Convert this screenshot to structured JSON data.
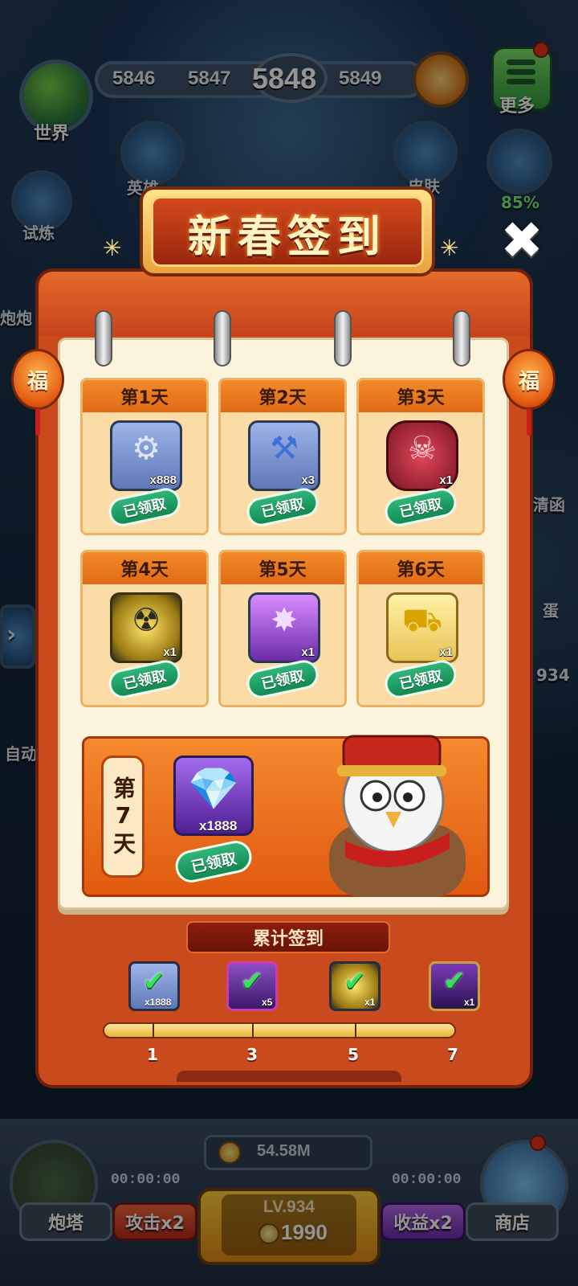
{
  "hud": {
    "world_label": "世界",
    "levels": [
      "5846",
      "5847",
      "5848",
      "5849"
    ],
    "more_label": "更多",
    "side_labels": {
      "hero": "英雄",
      "skin": "皮肤",
      "trial": "试炼",
      "cannon": "炮炮",
      "percent": "85%",
      "card": "清函",
      "egg": "蛋",
      "auto": "自动",
      "count": "934"
    }
  },
  "modal": {
    "title": "新春签到",
    "lantern_char": "福",
    "days": [
      {
        "label": "第1天",
        "qty": "x888",
        "status": "已领取",
        "icon": "gear-icon",
        "tile": "tile-blue"
      },
      {
        "label": "第2天",
        "qty": "x3",
        "status": "已领取",
        "icon": "anvil-icon",
        "tile": "tile-blue"
      },
      {
        "label": "第3天",
        "qty": "x1",
        "status": "已领取",
        "icon": "skull-icon",
        "tile": "tile-red"
      },
      {
        "label": "第4天",
        "qty": "x1",
        "status": "已领取",
        "icon": "radiation-icon",
        "tile": "tile-gold"
      },
      {
        "label": "第5天",
        "qty": "x1",
        "status": "已领取",
        "icon": "explosion-icon",
        "tile": "tile-purple"
      },
      {
        "label": "第6天",
        "qty": "x1",
        "status": "已领取",
        "icon": "tank-icon",
        "tile": "tile-yellow"
      }
    ],
    "day7": {
      "label": "第7天",
      "qty": "x1888",
      "status": "已领取",
      "icon": "gem-chest-icon"
    },
    "cumulative": {
      "title": "累计签到",
      "rewards": [
        {
          "qty": "x1888",
          "claimed": true,
          "icon": "gear-icon"
        },
        {
          "qty": "x5",
          "claimed": true,
          "icon": "potion-icon"
        },
        {
          "qty": "x1",
          "claimed": true,
          "icon": "rank-up-icon"
        },
        {
          "qty": "x1",
          "claimed": true,
          "icon": "chest-icon"
        }
      ],
      "milestones": [
        "1",
        "3",
        "5",
        "7"
      ],
      "progress_fraction": 1.0
    }
  },
  "bottom": {
    "coins": "54.58M",
    "tower_label": "炮塔",
    "attack_label": "攻击x2",
    "income_label": "收益x2",
    "shop_label": "商店",
    "timer_left": "00:00:00",
    "timer_right": "00:00:00",
    "level": "LV.934",
    "level_coins": "1990"
  },
  "colors": {
    "accent_orange": "#e05a10",
    "claimed_green": "#128a52",
    "paper": "#fbf3dc",
    "board_red": "#c94a1c"
  }
}
